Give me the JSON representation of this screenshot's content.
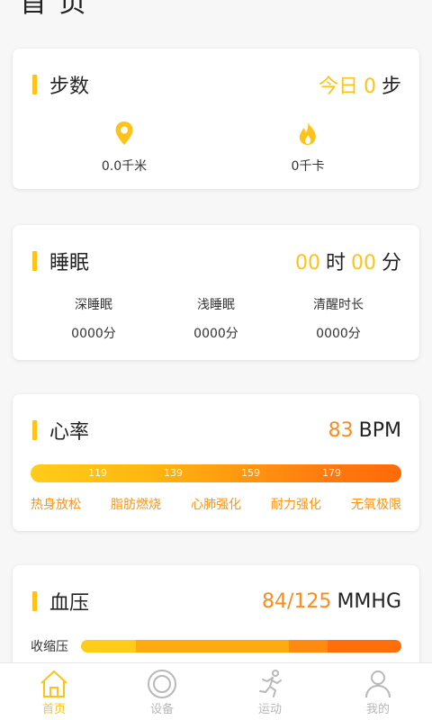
{
  "steps": {
    "title": "步数",
    "today_label": "今日",
    "count": "0",
    "unit": "步",
    "distance": "0.0千米",
    "calories": "0千卡"
  },
  "sleep": {
    "title": "睡眠",
    "hours": "00",
    "hours_unit": "时",
    "minutes": "00",
    "minutes_unit": "分",
    "columns": [
      {
        "label": "深睡眠",
        "value": "0000分"
      },
      {
        "label": "浅睡眠",
        "value": "0000分"
      },
      {
        "label": "清醒时长",
        "value": "0000分"
      }
    ]
  },
  "heart": {
    "title": "心率",
    "value": "83",
    "unit": "BPM",
    "ticks": [
      "119",
      "139",
      "159",
      "179"
    ],
    "zones": [
      "热身放松",
      "脂肪燃烧",
      "心肺强化",
      "耐力强化",
      "无氧极限"
    ]
  },
  "bp": {
    "title": "血压",
    "value": "84/125",
    "unit": "MMHG",
    "systolic_label": "收缩压"
  },
  "tabbar": {
    "items": [
      {
        "label": "首页",
        "icon": "home-icon",
        "active": true
      },
      {
        "label": "设备",
        "icon": "device-icon",
        "active": false
      },
      {
        "label": "运动",
        "icon": "running-icon",
        "active": false
      },
      {
        "label": "我的",
        "icon": "user-icon",
        "active": false
      }
    ]
  },
  "colors": {
    "accent": "#ffc21a",
    "orange": "#ff8a1c",
    "inactive": "#b8b8b8"
  }
}
